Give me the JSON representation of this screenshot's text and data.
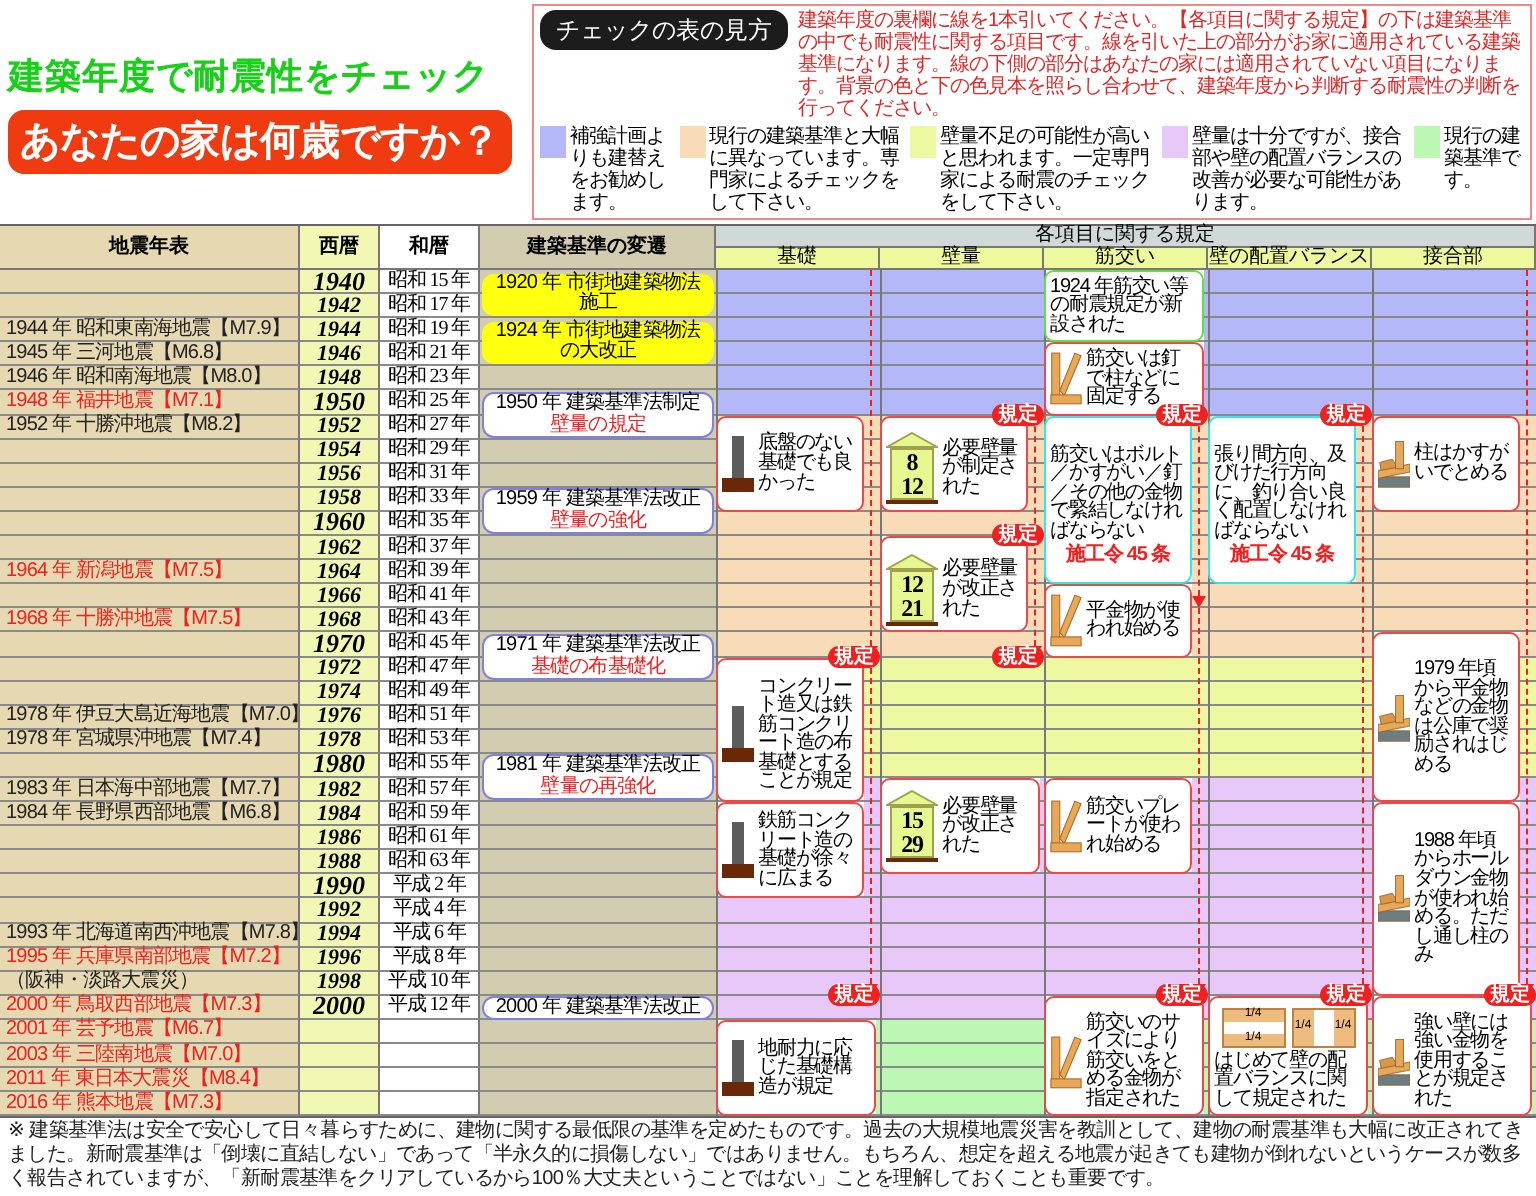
{
  "title": "建築年度で耐震性をチェック",
  "subtitle": "あなたの家は何歳ですか？",
  "legend": {
    "heading": "チェックの表の見方",
    "text": "建築年度の裏欄に線を1本引いてください。【各項目に関する規定】の下は建築基準の中でも耐震性に関する項目です。線を引いた上の部分がお家に適用されている建築基準になります。線の下側の部分はあなたの家には適用されていない項目になります。背景の色と下の色見本を照らし合わせて、建築年度から判断する耐震性の判断を行ってください。",
    "items": [
      {
        "color": "#b4b8f8",
        "text": "補強計画よりも建替えをお勧めします。"
      },
      {
        "color": "#f8dcb8",
        "text": "現行の建築基準と大幅に異なっています。専門家によるチェックをして下さい。"
      },
      {
        "color": "#eef8a0",
        "text": "壁量不足の可能性が高いと思われます。一定専門家による耐震のチェックをして下さい。"
      },
      {
        "color": "#e8c8f8",
        "text": "壁量は十分ですが、接合部や壁の配置バランスの改善が必要な可能性があります。"
      },
      {
        "color": "#bcf8b4",
        "text": "現行の建築基準です。"
      }
    ]
  },
  "table": {
    "columns": [
      "地震年表",
      "西暦",
      "和暦",
      "建築基準の変遷"
    ],
    "rules_heading": "各項目に関する規定",
    "rule_columns": [
      "基礎",
      "壁量",
      "筋交い",
      "壁の配置バランス",
      "接合部"
    ],
    "rows": [
      {
        "year": "1940",
        "major": true,
        "era": "昭和 15 年",
        "color": "#b4b8f8"
      },
      {
        "year": "1942",
        "major": false,
        "era": "昭和 17 年",
        "color": "#b4b8f8"
      },
      {
        "earthquake": "1944 年 昭和東南海地震【M7.9】",
        "red": false,
        "year": "1944",
        "major": false,
        "era": "昭和 19 年",
        "color": "#b4b8f8"
      },
      {
        "earthquake": "1945 年 三河地震【M6.8】",
        "red": false,
        "year": "1946",
        "major": false,
        "era": "昭和 21 年",
        "color": "#b4b8f8"
      },
      {
        "earthquake": "1946 年 昭和南海地震【M8.0】",
        "red": false,
        "year": "1948",
        "major": false,
        "era": "昭和 23 年",
        "color": "#b4b8f8"
      },
      {
        "earthquake": "1948 年 福井地震【M7.1】",
        "red": true,
        "year": "1950",
        "major": true,
        "era": "昭和 25 年",
        "color": "#b4b8f8"
      },
      {
        "earthquake": "1952 年 十勝沖地震【M8.2】",
        "red": false,
        "year": "1952",
        "major": false,
        "era": "昭和 27 年",
        "color": "#f8dcb8"
      },
      {
        "year": "1954",
        "major": false,
        "era": "昭和 29 年",
        "color": "#f8dcb8"
      },
      {
        "year": "1956",
        "major": false,
        "era": "昭和 31 年",
        "color": "#f8dcb8"
      },
      {
        "year": "1958",
        "major": false,
        "era": "昭和 33 年",
        "color": "#f8dcb8"
      },
      {
        "year": "1960",
        "major": true,
        "era": "昭和 35 年",
        "color": "#f8dcb8"
      },
      {
        "year": "1962",
        "major": false,
        "era": "昭和 37 年",
        "color": "#f8dcb8"
      },
      {
        "earthquake": "1964 年 新潟地震【M7.5】",
        "red": true,
        "year": "1964",
        "major": false,
        "era": "昭和 39 年",
        "color": "#f8dcb8"
      },
      {
        "year": "1966",
        "major": false,
        "era": "昭和 41 年",
        "color": "#f8dcb8"
      },
      {
        "earthquake": "1968 年 十勝沖地震【M7.5】",
        "red": true,
        "year": "1968",
        "major": false,
        "era": "昭和 43 年",
        "color": "#f8dcb8"
      },
      {
        "year": "1970",
        "major": true,
        "era": "昭和 45 年",
        "color": "#f8dcb8"
      },
      {
        "year": "1972",
        "major": false,
        "era": "昭和 47 年",
        "color": "#eef8a0"
      },
      {
        "year": "1974",
        "major": false,
        "era": "昭和 49 年",
        "color": "#eef8a0"
      },
      {
        "earthquake": "1978 年 伊豆大島近海地震【M7.0】",
        "red": false,
        "year": "1976",
        "major": false,
        "era": "昭和 51 年",
        "color": "#eef8a0"
      },
      {
        "earthquake": "1978 年 宮城県沖地震【M7.4】",
        "red": false,
        "year": "1978",
        "major": false,
        "era": "昭和 53 年",
        "color": "#eef8a0"
      },
      {
        "year": "1980",
        "major": true,
        "era": "昭和 55 年",
        "color": "#eef8a0"
      },
      {
        "earthquake": "1983 年 日本海中部地震【M7.7】",
        "red": false,
        "year": "1982",
        "major": false,
        "era": "昭和 57 年",
        "color": "#e8c8f8"
      },
      {
        "earthquake": "1984 年 長野県西部地震【M6.8】",
        "red": false,
        "year": "1984",
        "major": false,
        "era": "昭和 59 年",
        "color": "#e8c8f8"
      },
      {
        "year": "1986",
        "major": false,
        "era": "昭和 61 年",
        "color": "#e8c8f8"
      },
      {
        "year": "1988",
        "major": false,
        "era": "昭和 63 年",
        "color": "#e8c8f8"
      },
      {
        "year": "1990",
        "major": true,
        "era": "平成 2 年",
        "color": "#e8c8f8"
      },
      {
        "year": "1992",
        "major": false,
        "era": "平成 4 年",
        "color": "#e8c8f8"
      },
      {
        "earthquake": "1993 年 北海道南西沖地震【M7.8】",
        "red": false,
        "year": "1994",
        "major": false,
        "era": "平成 6 年",
        "color": "#e8c8f8"
      },
      {
        "earthquake": "1995 年 兵庫県南部地震【M7.2】",
        "red": true,
        "year": "1996",
        "major": false,
        "era": "平成 8 年",
        "color": "#e8c8f8"
      },
      {
        "earthquake": "（阪神・淡路大震災）",
        "red": false,
        "year": "1998",
        "major": false,
        "era": "平成 10 年",
        "color": "#e8c8f8"
      },
      {
        "earthquake": "2000 年 鳥取西部地震【M7.3】",
        "red": true,
        "year": "2000",
        "major": true,
        "era": "平成 12 年",
        "color": "#e8c8f8"
      },
      {
        "earthquake": "2001 年 芸予地震【M6.7】",
        "red": true,
        "color": "#bcf8b4"
      },
      {
        "earthquake": "2003 年 三陸南地震【M7.0】",
        "red": true,
        "color": "#bcf8b4"
      },
      {
        "earthquake": "2011 年 東日本大震災【M8.4】",
        "red": true,
        "color": "#bcf8b4"
      },
      {
        "earthquake": "2016 年 熊本地震【M7.3】",
        "red": true,
        "color": "#bcf8b4"
      }
    ]
  },
  "law_changes": [
    {
      "kind": "highlight",
      "text": "1920 年 市街地建築物法施工"
    },
    {
      "kind": "highlight",
      "text": "1924 年 市街地建築物法の大改正"
    },
    {
      "kind": "box",
      "text": "1950 年 建築基準法制定",
      "detail": "壁量の規定"
    },
    {
      "kind": "box",
      "text": "1959 年 建築基準法改正",
      "detail": "壁量の強化"
    },
    {
      "kind": "box",
      "text": "1971 年 建築基準法改正",
      "detail": "基礎の布基礎化"
    },
    {
      "kind": "box",
      "text": "1981 年 建築基準法改正",
      "detail": "壁量の再強化"
    },
    {
      "kind": "box",
      "text": "2000 年 建築基準法改正"
    }
  ],
  "callouts": [
    {
      "kind": "foundation",
      "color": "#f04848",
      "text": "底盤のない基礎でも良かった"
    },
    {
      "kind": "foundation",
      "color": "#f04848",
      "text": "コンクリート造又は鉄筋コンクリート造の布基礎とすることが規定"
    },
    {
      "kind": "foundation",
      "color": "#f04848",
      "text": "鉄筋コンクリート造の基礎が徐々に広まる"
    },
    {
      "kind": "foundation",
      "color": "#f04848",
      "text": "地耐力に応じた基礎構造が規定"
    },
    {
      "kind": "wall_ratio",
      "color": "#f04848",
      "numbers": [
        "8",
        "12"
      ],
      "text": "必要壁量が制定された"
    },
    {
      "kind": "wall_ratio",
      "color": "#f04848",
      "numbers": [
        "12",
        "21"
      ],
      "text": "必要壁量が改正された"
    },
    {
      "kind": "wall_ratio",
      "color": "#f04848",
      "numbers": [
        "15",
        "29"
      ],
      "text": "必要壁量が改正された"
    },
    {
      "kind": "note",
      "color": "#60e040",
      "text": "1924 年筋交い等の耐震規定が新設された"
    },
    {
      "kind": "brace",
      "color": "#f04848",
      "text": "筋交いは釘で柱などに固定する"
    },
    {
      "kind": "note",
      "color": "#30e8f0",
      "text": "筋交いはボルト／かすがい／釘／その他の金物で緊結しなければならない",
      "note": "施工令 45 条"
    },
    {
      "kind": "brace",
      "color": "#f04848",
      "text": "平金物が使われ始める"
    },
    {
      "kind": "brace",
      "color": "#f04848",
      "text": "筋交いプレートが使われ始める"
    },
    {
      "kind": "brace",
      "color": "#f04848",
      "text": "筋交いのサイズにより筋交いをとめる金物が指定された"
    },
    {
      "kind": "note",
      "color": "#30e8f0",
      "text": "張り間方向、及びけた行方向に、釣り合い良く配置しなければならない",
      "note": "施工令 45 条"
    },
    {
      "kind": "balance",
      "color": "#f04848",
      "labels": [
        "1/4",
        "1/4",
        "1/4",
        "1/4"
      ],
      "text": "はじめて壁の配置バランスに関して規定された"
    },
    {
      "kind": "joint",
      "color": "#f04848",
      "text": "柱はかすがいでとめる"
    },
    {
      "kind": "joint",
      "color": "#f04848",
      "text": "1979 年頃から平金物などの金物は公庫で奨励されはじめる"
    },
    {
      "kind": "joint",
      "color": "#f04848",
      "text": "1988 年頃からホールダウン金物が使われ始める。ただし通し柱のみ"
    },
    {
      "kind": "joint",
      "color": "#f04848",
      "text": "強い壁には強い金物を使用することが規定された"
    }
  ],
  "badges": [
    "規定",
    "規定",
    "規定",
    "規定",
    "規定",
    "規定",
    "規定",
    "規定",
    "規定",
    "規定"
  ],
  "footnote": "※ 建築基準法は安全で安心して日々暮らすために、建物に関する最低限の基準を定めたものです。過去の大規模地震災害を教訓として、建物の耐震基準も大幅に改正されてきました。新耐震基準は「倒壊に直結しない」であって「半永久的に損傷しない」ではありません。もちろん、想定を超える地震が起きても建物が倒れないというケースが数多く報告されていますが、「新耐震基準をクリアしているから100％大丈夫ということではない」ことを理解しておくことも重要です。"
}
